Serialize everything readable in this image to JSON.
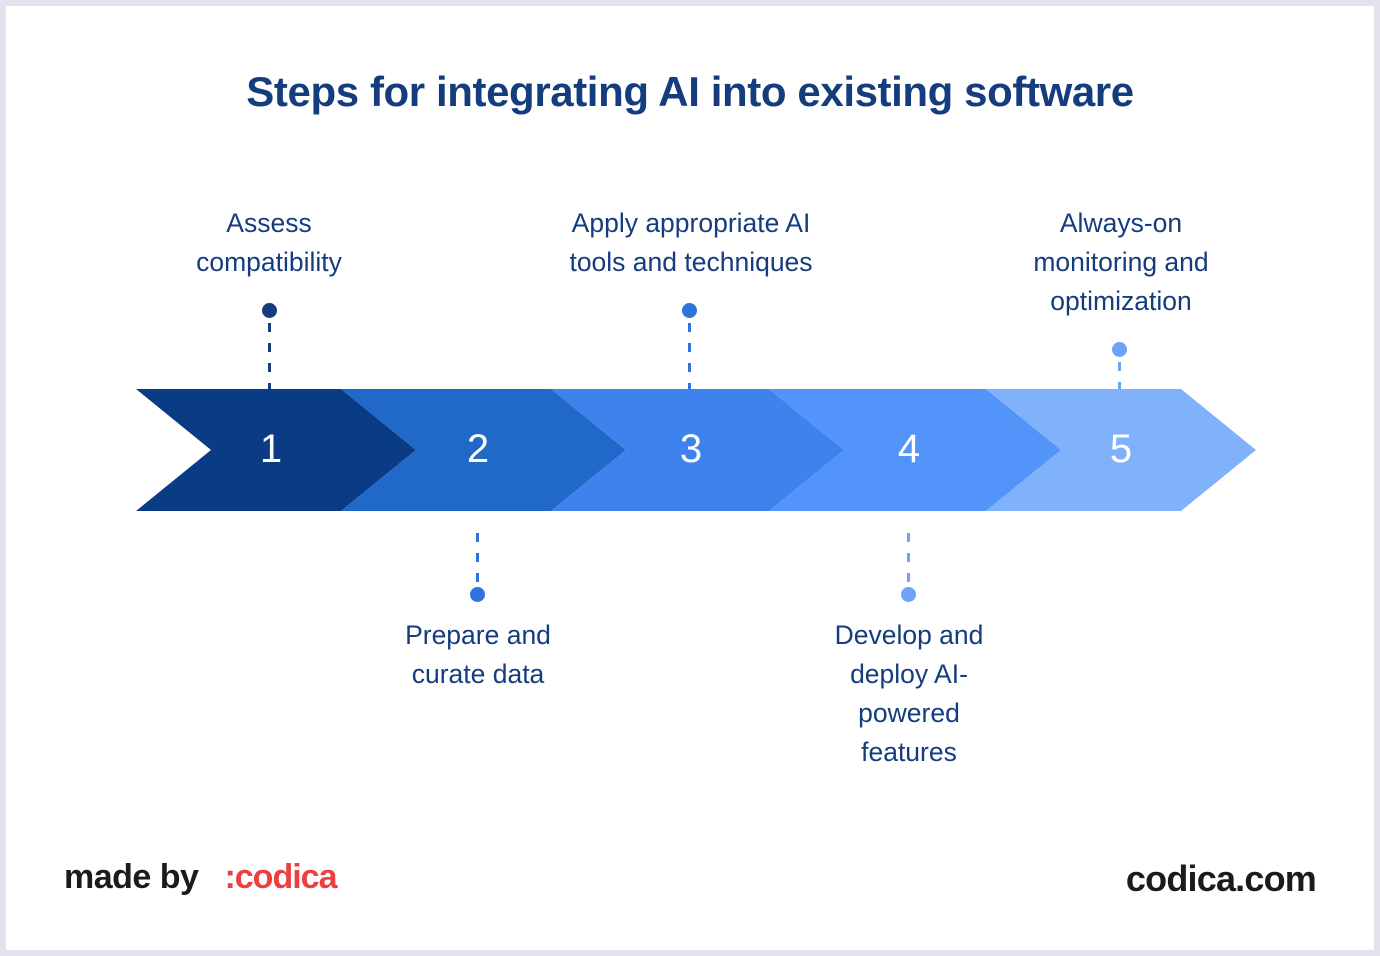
{
  "canvas": {
    "background": "#ffffff",
    "frame_color": "#e2e2ee"
  },
  "title": "Steps for integrating AI into existing software",
  "title_color": "#153D7E",
  "chart_data": {
    "type": "diagram",
    "subtype": "chevron-process-arrow",
    "title": "Steps for integrating AI into existing software",
    "orientation": "horizontal",
    "step_count": 5,
    "steps": [
      {
        "number": "1",
        "label": "Assess compatibility",
        "label_lines": [
          "Assess",
          "compatibility"
        ],
        "label_position": "above",
        "color": "#0A3B85",
        "dot_color": "#153D7E"
      },
      {
        "number": "2",
        "label": "Prepare and curate data",
        "label_lines": [
          "Prepare and",
          "curate data"
        ],
        "label_position": "below",
        "color": "#2169C9",
        "dot_color": "#2E74DC"
      },
      {
        "number": "3",
        "label": "Apply appropriate AI tools and techniques",
        "label_lines": [
          "Apply appropriate AI",
          "tools and techniques"
        ],
        "label_position": "above",
        "color": "#3E82EE",
        "dot_color": "#2E74DC"
      },
      {
        "number": "4",
        "label": "Develop and deploy AI-powered features",
        "label_lines": [
          "Develop and",
          "deploy AI-",
          "powered",
          "features"
        ],
        "label_position": "below",
        "color": "#5294FA",
        "dot_color": "#6EA4F7"
      },
      {
        "number": "5",
        "label": "Always-on monitoring and optimization",
        "label_lines": [
          "Always-on",
          "monitoring and",
          "optimization"
        ],
        "label_position": "above",
        "color": "#7FB2FB",
        "dot_color": "#6EA4F7"
      }
    ],
    "label_color": "#153D7E",
    "number_color": "#ffffff"
  },
  "footer": {
    "made_by": "made by",
    "brand": ":codica",
    "brand_color": "#ec3f3f",
    "website": "codica.com"
  }
}
